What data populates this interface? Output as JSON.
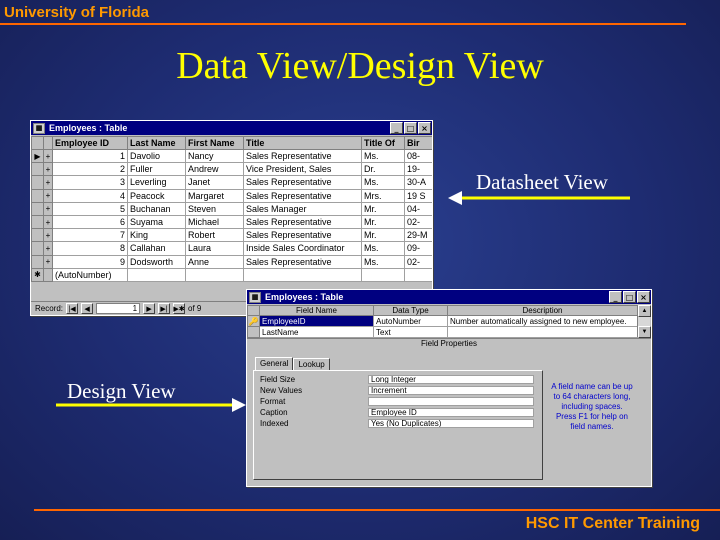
{
  "header": {
    "institution": "University of Florida"
  },
  "slide": {
    "title": "Data View/Design View"
  },
  "footer": {
    "text": "HSC IT Center Training"
  },
  "colors": {
    "background": "#1e2c72",
    "header_text": "#ff9900",
    "rule": "#ff6600",
    "title": "#ffff00",
    "callout": "#ffffff",
    "window_title": "#000080"
  },
  "callouts": {
    "datasheet": "Datasheet View",
    "design": "Design View"
  },
  "datasheet_window": {
    "title": "Employees : Table",
    "controls": [
      "_",
      "□",
      "×"
    ],
    "columns": [
      "",
      "Employee ID",
      "Last Name",
      "First Name",
      "Title",
      "Title Of",
      "Bir"
    ],
    "rows": [
      {
        "marker": "▶",
        "expand": "+",
        "id": "1",
        "last": "Davolio",
        "first": "Nancy",
        "title": "Sales Representative",
        "title_of": "Ms.",
        "birth": "08-"
      },
      {
        "marker": "",
        "expand": "+",
        "id": "2",
        "last": "Fuller",
        "first": "Andrew",
        "title": "Vice President, Sales",
        "title_of": "Dr.",
        "birth": "19-"
      },
      {
        "marker": "",
        "expand": "+",
        "id": "3",
        "last": "Leverling",
        "first": "Janet",
        "title": "Sales Representative",
        "title_of": "Ms.",
        "birth": "30-A"
      },
      {
        "marker": "",
        "expand": "+",
        "id": "4",
        "last": "Peacock",
        "first": "Margaret",
        "title": "Sales Representative",
        "title_of": "Mrs.",
        "birth": "19 S"
      },
      {
        "marker": "",
        "expand": "+",
        "id": "5",
        "last": "Buchanan",
        "first": "Steven",
        "title": "Sales Manager",
        "title_of": "Mr.",
        "birth": "04-"
      },
      {
        "marker": "",
        "expand": "+",
        "id": "6",
        "last": "Suyama",
        "first": "Michael",
        "title": "Sales Representative",
        "title_of": "Mr.",
        "birth": "02-"
      },
      {
        "marker": "",
        "expand": "+",
        "id": "7",
        "last": "King",
        "first": "Robert",
        "title": "Sales Representative",
        "title_of": "Mr.",
        "birth": "29-M"
      },
      {
        "marker": "",
        "expand": "+",
        "id": "8",
        "last": "Callahan",
        "first": "Laura",
        "title": "Inside Sales Coordinator",
        "title_of": "Ms.",
        "birth": "09-"
      },
      {
        "marker": "",
        "expand": "+",
        "id": "9",
        "last": "Dodsworth",
        "first": "Anne",
        "title": "Sales Representative",
        "title_of": "Ms.",
        "birth": "02-"
      },
      {
        "marker": "✱",
        "expand": "",
        "id": "(AutoNumber)",
        "last": "",
        "first": "",
        "title": "",
        "title_of": "",
        "birth": ""
      }
    ],
    "navigation": {
      "label": "Record:",
      "current": "1",
      "of_text": "of 9"
    }
  },
  "design_window": {
    "title": "Employees : Table",
    "controls": [
      "_",
      "□",
      "×"
    ],
    "columns": [
      "",
      "Field Name",
      "Data Type",
      "Description"
    ],
    "rows": [
      {
        "marker": "🔑",
        "field": "EmployeeID",
        "type": "AutoNumber",
        "desc": "Number automatically assigned to new employee."
      },
      {
        "marker": "",
        "field": "LastName",
        "type": "Text",
        "desc": ""
      }
    ],
    "field_properties_label": "Field Properties",
    "tabs": [
      "General",
      "Lookup"
    ],
    "properties": [
      {
        "label": "Field Size",
        "value": "Long Integer"
      },
      {
        "label": "New Values",
        "value": "Increment"
      },
      {
        "label": "Format",
        "value": ""
      },
      {
        "label": "Caption",
        "value": "Employee ID"
      },
      {
        "label": "Indexed",
        "value": "Yes (No Duplicates)"
      }
    ],
    "help_text": "A field name can be up to 64 characters long, including spaces. Press F1 for help on field names."
  }
}
